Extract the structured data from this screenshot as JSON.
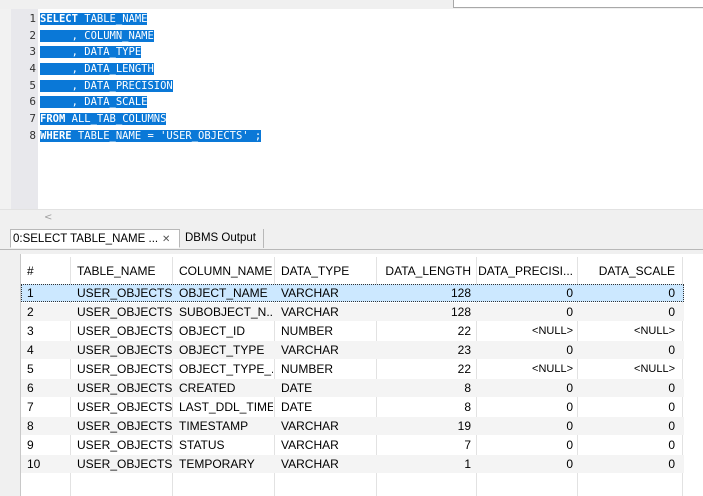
{
  "editor": {
    "line_numbers": [
      "1",
      "2",
      "3",
      "4",
      "5",
      "6",
      "7",
      "8"
    ],
    "lines": [
      {
        "kw": "SELECT",
        "text": " TABLE_NAME"
      },
      {
        "kw": "",
        "text": "     , COLUMN_NAME"
      },
      {
        "kw": "",
        "text": "     , DATA_TYPE"
      },
      {
        "kw": "",
        "text": "     , DATA_LENGTH"
      },
      {
        "kw": "",
        "text": "     , DATA_PRECISION"
      },
      {
        "kw": "",
        "text": "     , DATA_SCALE"
      },
      {
        "kw": "FROM",
        "text": " ALL_TAB_COLUMNS"
      },
      {
        "kw": "WHERE",
        "text": " TABLE_NAME = 'USER_OBJECTS' ;"
      }
    ],
    "selection_color": "#0a78d7",
    "scroll_left_glyph": "<"
  },
  "tabs": {
    "results_tab_label": "0:SELECT TABLE_NAME  ...",
    "close_glyph": "✕",
    "dbms_output_label": "DBMS Output"
  },
  "grid": {
    "headers": [
      "#",
      "TABLE_NAME",
      "COLUMN_NAME",
      "DATA_TYPE",
      "DATA_LENGTH",
      "DATA_PRECISI...",
      "DATA_SCALE"
    ],
    "rows": [
      [
        "1",
        "USER_OBJECTS",
        "OBJECT_NAME",
        "VARCHAR",
        "128",
        "0",
        "0"
      ],
      [
        "2",
        "USER_OBJECTS",
        "SUBOBJECT_N...",
        "VARCHAR",
        "128",
        "0",
        "0"
      ],
      [
        "3",
        "USER_OBJECTS",
        "OBJECT_ID",
        "NUMBER",
        "22",
        "<NULL>",
        "<NULL>"
      ],
      [
        "4",
        "USER_OBJECTS",
        "OBJECT_TYPE",
        "VARCHAR",
        "23",
        "0",
        "0"
      ],
      [
        "5",
        "USER_OBJECTS",
        "OBJECT_TYPE_...",
        "NUMBER",
        "22",
        "<NULL>",
        "<NULL>"
      ],
      [
        "6",
        "USER_OBJECTS",
        "CREATED",
        "DATE",
        "8",
        "0",
        "0"
      ],
      [
        "7",
        "USER_OBJECTS",
        "LAST_DDL_TIME",
        "DATE",
        "8",
        "0",
        "0"
      ],
      [
        "8",
        "USER_OBJECTS",
        "TIMESTAMP",
        "VARCHAR",
        "19",
        "0",
        "0"
      ],
      [
        "9",
        "USER_OBJECTS",
        "STATUS",
        "VARCHAR",
        "7",
        "0",
        "0"
      ],
      [
        "10",
        "USER_OBJECTS",
        "TEMPORARY",
        "VARCHAR",
        "1",
        "0",
        "0"
      ]
    ],
    "selected_row": 1,
    "selected_color": "#cce8ff"
  }
}
